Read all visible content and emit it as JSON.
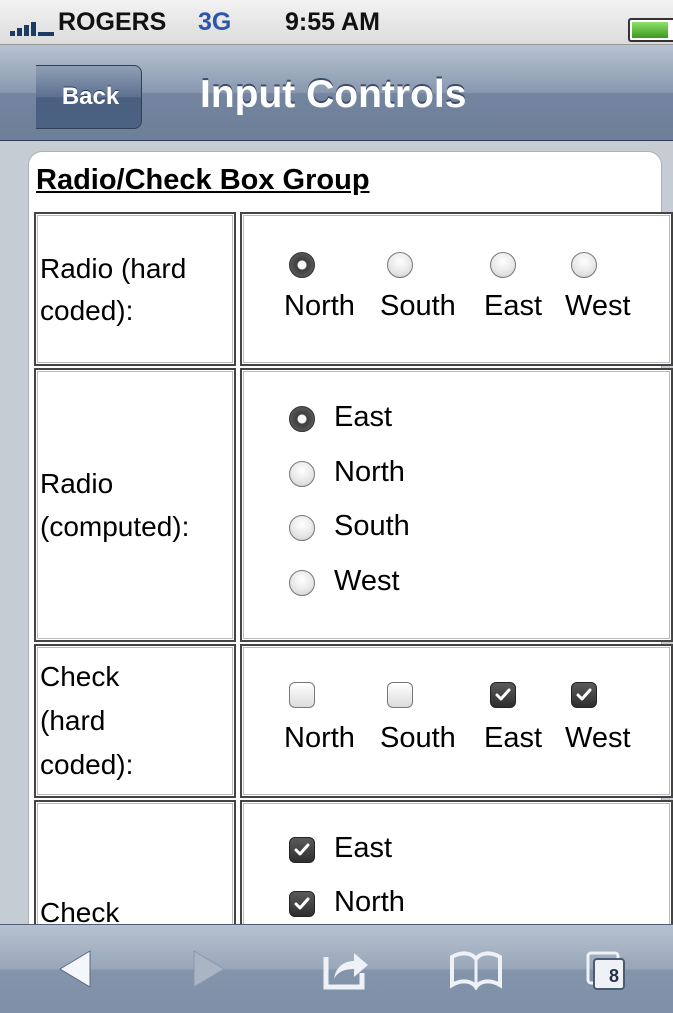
{
  "status_bar": {
    "carrier": "ROGERS",
    "network": "3G",
    "time": "9:55 AM"
  },
  "nav": {
    "back_label": "Back",
    "title": "Input Controls"
  },
  "group": {
    "title": "Radio/Check Box Group"
  },
  "rows": {
    "radio_hard": {
      "label": "Radio (hard coded):",
      "line1": "Radio (hard",
      "line2": "coded):",
      "options": [
        "North",
        "South",
        "East",
        "West"
      ],
      "selected": "North"
    },
    "radio_computed": {
      "label": "Radio (computed):",
      "line1": "Radio",
      "line2": "(computed):",
      "options": [
        "East",
        "North",
        "South",
        "West"
      ],
      "selected": "East"
    },
    "check_hard": {
      "label": "Check (hard coded):",
      "line1": "Check",
      "line2": "(hard",
      "line3": "coded):",
      "options": [
        "North",
        "South",
        "East",
        "West"
      ],
      "checked": [
        "East",
        "West"
      ]
    },
    "check_computed": {
      "label": "Check",
      "line1": "Check",
      "options": [
        "East",
        "North"
      ],
      "checked": [
        "East",
        "North"
      ]
    }
  },
  "toolbar": {
    "icons": [
      "back-arrow-icon",
      "forward-arrow-icon",
      "share-icon",
      "bookmarks-icon",
      "tabs-icon"
    ],
    "tabs_count": "8"
  },
  "colors": {
    "nav_bar": "#7485a0",
    "background": "#c5ccd4",
    "network_text": "#2d56a8"
  }
}
